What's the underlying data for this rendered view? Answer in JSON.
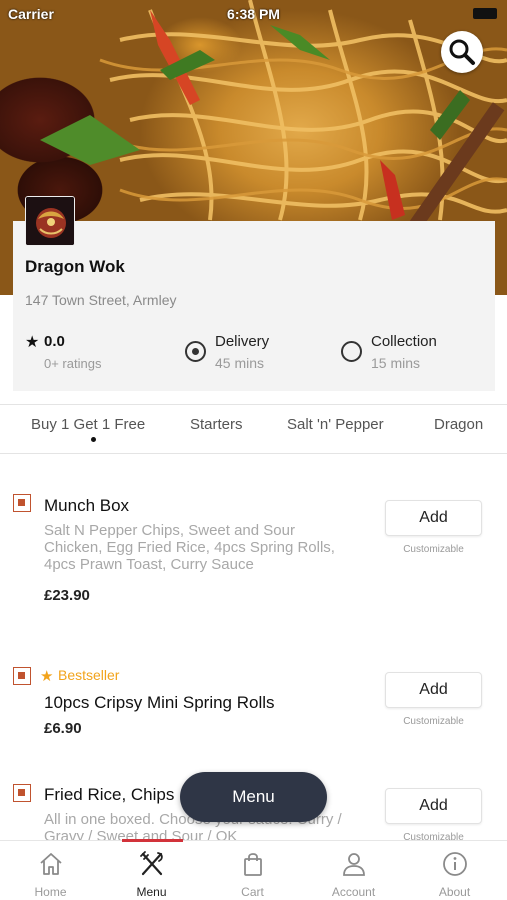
{
  "status_bar": {
    "carrier": "Carrier",
    "time": "6:38 PM"
  },
  "restaurant": {
    "name": "Dragon Wok",
    "address": "147 Town Street, Armley",
    "rating": "0.0",
    "rating_count": "0+ ratings"
  },
  "options": {
    "delivery": {
      "title": "Delivery",
      "time": "45 mins",
      "selected": true
    },
    "collection": {
      "title": "Collection",
      "time": "15 mins",
      "selected": false
    }
  },
  "category_tabs": [
    "Buy 1 Get 1 Free",
    "Starters",
    "Salt 'n' Pepper",
    "Dragon"
  ],
  "items": [
    {
      "name": "Munch Box",
      "description": "Salt N Pepper Chips, Sweet and Sour Chicken, Egg Fried Rice, 4pcs Spring Rolls, 4pcs Prawn Toast, Curry Sauce",
      "price": "£23.90",
      "add_label": "Add",
      "customizable": "Customizable"
    },
    {
      "badge": "Bestseller",
      "name": "10pcs Cripsy Mini Spring Rolls",
      "price": "£6.90",
      "add_label": "Add",
      "customizable": "Customizable"
    },
    {
      "name": "Fried Rice, Chips",
      "description": "All in one boxed. Choose your sauce: Curry / Gravy / Sweet and Sour / OK",
      "add_label": "Add",
      "customizable": "Customizable"
    }
  ],
  "floating_menu_label": "Menu",
  "bottom_nav": [
    {
      "label": "Home",
      "icon": "home-icon"
    },
    {
      "label": "Menu",
      "icon": "fork-knife-icon",
      "active": true
    },
    {
      "label": "Cart",
      "icon": "shopping-bag-icon"
    },
    {
      "label": "Account",
      "icon": "user-icon"
    },
    {
      "label": "About",
      "icon": "info-icon"
    }
  ],
  "colors": {
    "accent_red": "#d2323a",
    "veg_marker": "#c0532f",
    "bestseller": "#f2a31b",
    "pill_bg": "#2f3646"
  }
}
